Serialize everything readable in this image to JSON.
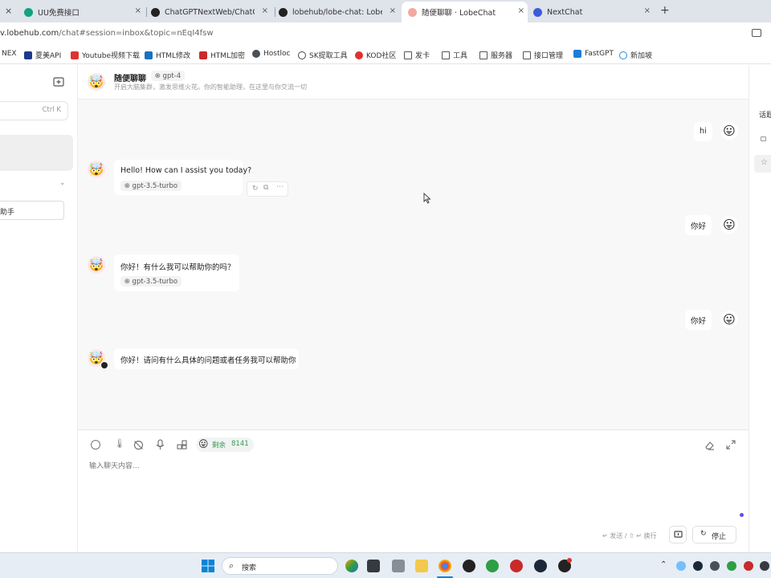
{
  "browser": {
    "tabs": [
      {
        "title": "UU免费接口",
        "close": "×"
      },
      {
        "title": "ChatGPTNextWeb/ChatGPT-",
        "close": "×"
      },
      {
        "title": "lobehub/lobe-chat: Lobe",
        "close": "×"
      },
      {
        "title": "随便聊聊 · LobeChat",
        "close": "×"
      },
      {
        "title": "NextChat",
        "close": "×"
      }
    ],
    "first_tab_close": "×",
    "new_tab": "+",
    "url_host": "v.lobehub.com",
    "url_path": "/chat#session=inbox&topic=nEqI4fsw",
    "bookmarks": [
      "NEX",
      "夏美API",
      "Youtube视频下载",
      "HTML修改",
      "HTML加密",
      "Hostloc",
      "SK提取工具",
      "KOD社区",
      "发卡",
      "工具",
      "服务器",
      "接口管理",
      "FastGPT",
      "新加坡"
    ]
  },
  "sidebar": {
    "search_shortcut": "Ctrl K",
    "assistant_item": "助手"
  },
  "header": {
    "title": "随便聊聊",
    "model": "gpt-4",
    "subtitle": "开启大脑集群，激发思维火花。你的智能助理，在这里与你交流一切"
  },
  "messages": [
    {
      "role": "user",
      "text": "hi"
    },
    {
      "role": "assistant",
      "text": "Hello! How can I assist you today?",
      "model": "gpt-3.5-turbo"
    },
    {
      "role": "user",
      "text": "你好"
    },
    {
      "role": "assistant",
      "text": "你好！有什么我可以帮助你的吗？",
      "model": "gpt-3.5-turbo"
    },
    {
      "role": "user",
      "text": "你好"
    },
    {
      "role": "assistant",
      "text": "你好！请问有什么具体的问题或者任务我可以帮助你"
    }
  ],
  "input": {
    "token_label": "剩余",
    "token_count": "8141",
    "placeholder": "输入聊天内容...",
    "hint": "↵ 发送 / ⇧ ↵ 换行",
    "stop_label": "停止"
  },
  "right_panel": {
    "label": "话题"
  },
  "taskbar": {
    "search": "搜索"
  },
  "colors": {
    "accent_green": "#2f9e44",
    "text_gray": "#888888",
    "dot_purple": "#7048e8"
  }
}
